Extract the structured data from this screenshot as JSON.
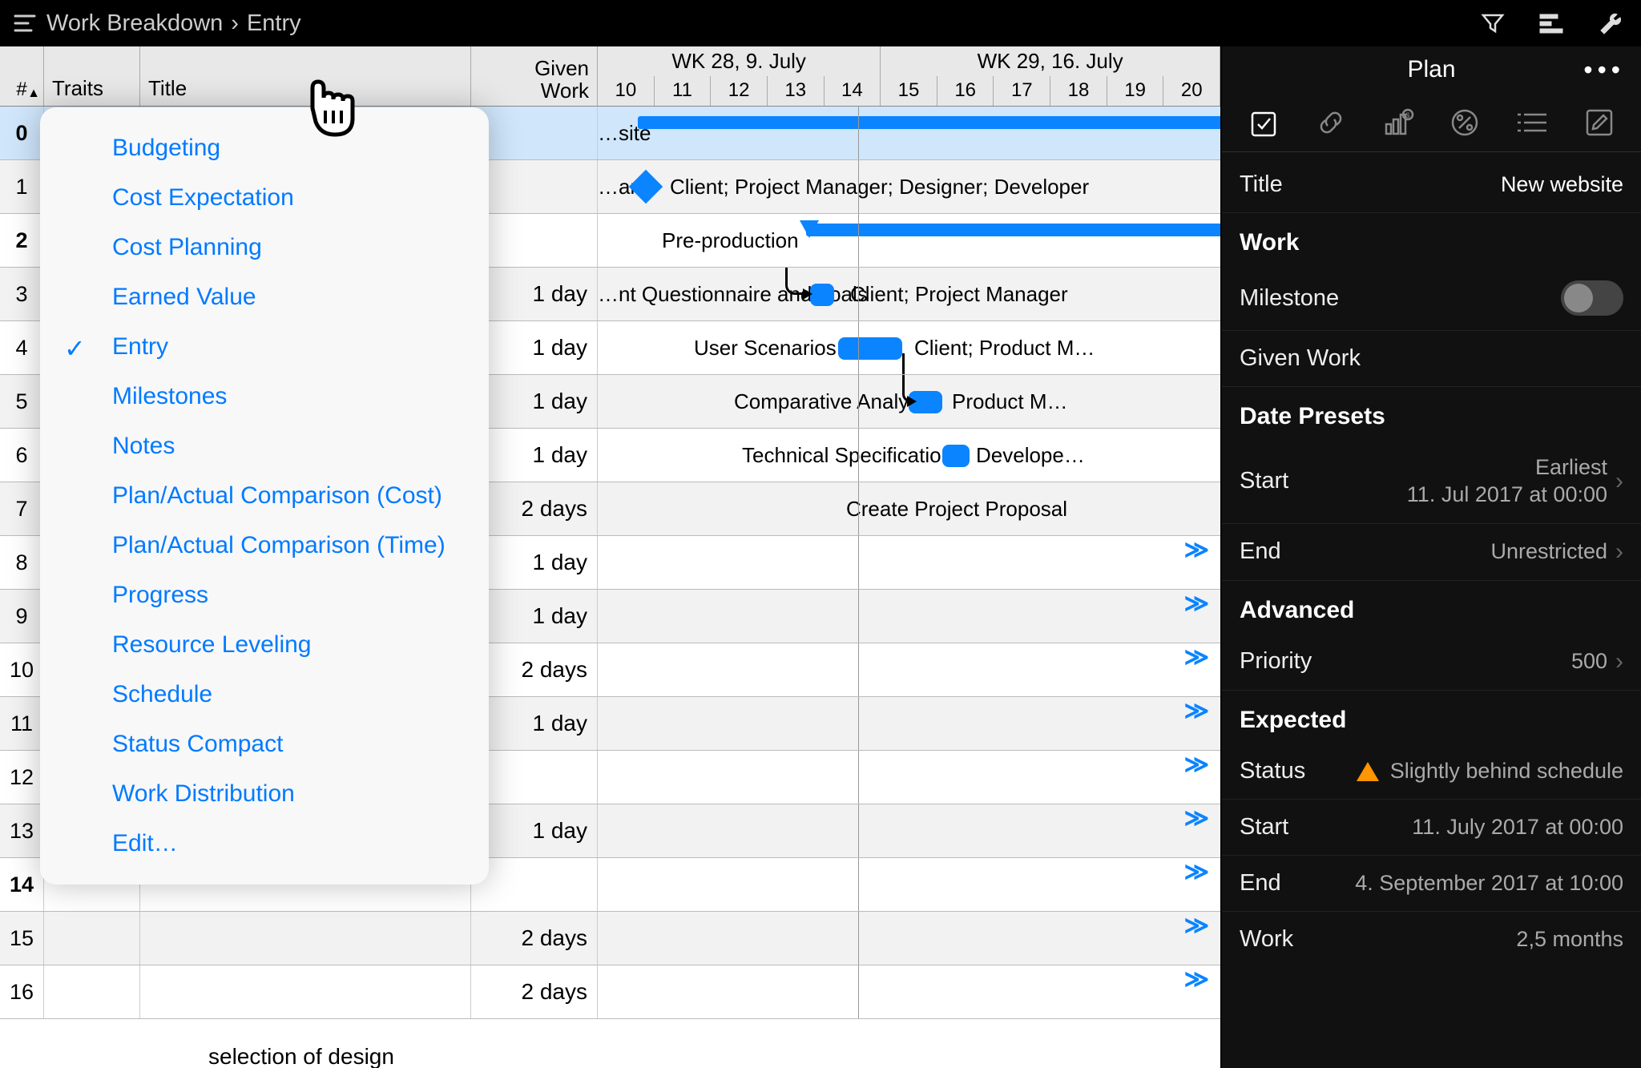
{
  "breadcrumb": {
    "root": "Work Breakdown",
    "sep": "›",
    "current": "Entry"
  },
  "table": {
    "headers": {
      "num": "#",
      "traits": "Traits",
      "title": "Title",
      "work1": "Given",
      "work2": "Work"
    },
    "weeks": [
      "WK 28, 9. July",
      "WK 29, 16. July"
    ],
    "days": [
      "10",
      "11",
      "12",
      "13",
      "14",
      "15",
      "16",
      "17",
      "18",
      "19",
      "20"
    ],
    "rows": [
      {
        "n": "0",
        "work": "",
        "sel": true,
        "bold": true
      },
      {
        "n": "1",
        "work": ""
      },
      {
        "n": "2",
        "work": "",
        "bold": true
      },
      {
        "n": "3",
        "work": "1 day"
      },
      {
        "n": "4",
        "work": "1 day"
      },
      {
        "n": "5",
        "work": "1 day"
      },
      {
        "n": "6",
        "work": "1 day"
      },
      {
        "n": "7",
        "work": "2 days"
      },
      {
        "n": "8",
        "work": "1 day"
      },
      {
        "n": "9",
        "work": "1 day"
      },
      {
        "n": "10",
        "work": "2 days"
      },
      {
        "n": "11",
        "work": "1 day"
      },
      {
        "n": "12",
        "work": ""
      },
      {
        "n": "13",
        "work": "1 day"
      },
      {
        "n": "14",
        "work": "",
        "bold": true
      },
      {
        "n": "15",
        "work": "2 days"
      },
      {
        "n": "16",
        "work": "2 days"
      }
    ],
    "bottom_peek": "selection of design"
  },
  "gantt": {
    "r0_label": "…site",
    "r1_label": "…art",
    "r1_res": "Client; Project Manager; Designer; Developer",
    "r2_label": "Pre-production",
    "r3_label": "…nt Questionnaire and goals",
    "r3_res": "Client; Project Manager",
    "r4_label": "User Scenarios",
    "r4_res": "Client; Product M…",
    "r5_label": "Comparative Analysis",
    "r5_res": "Product M…",
    "r6_label": "Technical Specifications",
    "r6_res": "Develope…",
    "r7_label": "Create Project Proposal"
  },
  "dropdown": {
    "items": [
      "Budgeting",
      "Cost Expectation",
      "Cost Planning",
      "Earned Value",
      "Entry",
      "Milestones",
      "Notes",
      "Plan/Actual Comparison (Cost)",
      "Plan/Actual Comparison (Time)",
      "Progress",
      "Resource Leveling",
      "Schedule",
      "Status Compact",
      "Work Distribution",
      "Edit…"
    ],
    "selected": 4
  },
  "inspector": {
    "header": "Plan",
    "title_label": "Title",
    "title_value": "New website",
    "sec_work": "Work",
    "milestone": "Milestone",
    "given_work": "Given Work",
    "sec_dates": "Date Presets",
    "start_label": "Start",
    "start_v1": "Earliest",
    "start_v2": "11. Jul 2017 at 00:00",
    "end_label": "End",
    "end_value": "Unrestricted",
    "sec_adv": "Advanced",
    "priority": "Priority",
    "priority_v": "500",
    "sec_exp": "Expected",
    "status": "Status",
    "status_v": "Slightly behind schedule",
    "estart": "Start",
    "estart_v": "11. July 2017 at 00:00",
    "eend": "End",
    "eend_v": "4. September 2017 at 10:00",
    "ework": "Work",
    "ework_v": "2,5 months"
  }
}
